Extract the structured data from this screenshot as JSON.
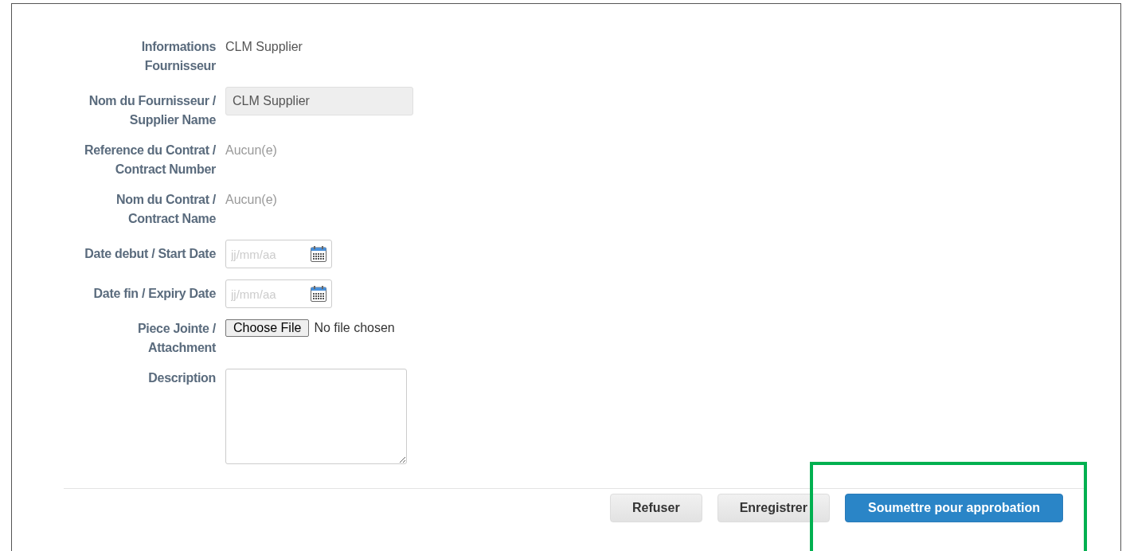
{
  "form": {
    "fields": [
      {
        "kind": "text",
        "label": "Informations Fournisseur",
        "value": "CLM Supplier"
      },
      {
        "kind": "readonly",
        "label": "Nom du Fournisseur / Supplier Name",
        "value": "CLM Supplier"
      },
      {
        "kind": "none",
        "label": "Reference du Contrat / Contract Number",
        "value": "Aucun(e)"
      },
      {
        "kind": "none",
        "label": "Nom du Contrat / Contract Name",
        "value": "Aucun(e)"
      },
      {
        "kind": "date",
        "label": "Date debut / Start Date",
        "placeholder": "jj/mm/aa"
      },
      {
        "kind": "date",
        "label": "Date fin / Expiry Date",
        "placeholder": "jj/mm/aa"
      },
      {
        "kind": "file",
        "label": "Piece Jointe / Attachment",
        "button": "Choose File",
        "status": "No file chosen"
      },
      {
        "kind": "textarea",
        "label": "Description"
      }
    ]
  },
  "actions": [
    {
      "kind": "secondary",
      "label": "Refuser",
      "highlighted": false
    },
    {
      "kind": "secondary",
      "label": "Enregistrer",
      "highlighted": false
    },
    {
      "kind": "primary",
      "label": "Soumettre pour approbation",
      "highlighted": true
    }
  ]
}
